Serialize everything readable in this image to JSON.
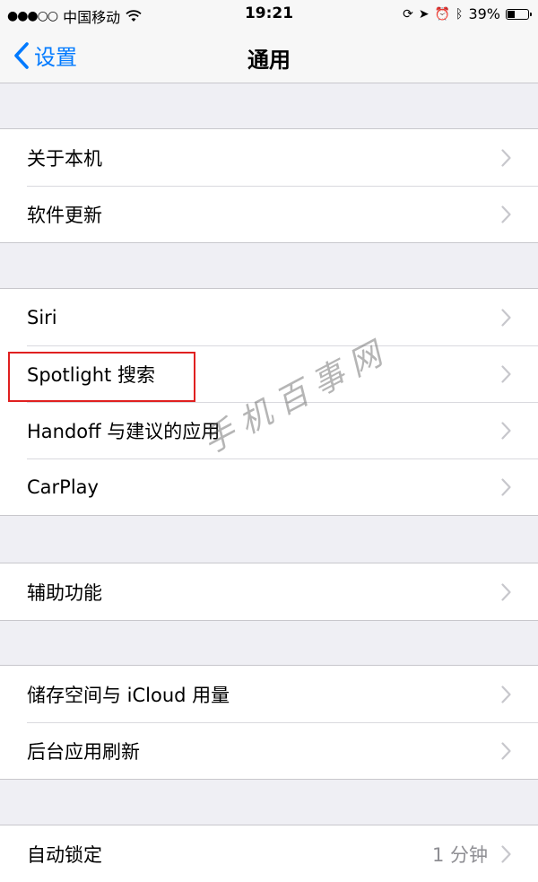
{
  "status_bar": {
    "signal": "●●●○○",
    "carrier": "中国移动",
    "time": "19:21",
    "battery_percent": "39%",
    "battery_level": 0.39,
    "icons": [
      "wifi-icon",
      "rotation-lock-icon",
      "location-arrow-icon",
      "alarm-icon",
      "bluetooth-icon",
      "battery-icon"
    ]
  },
  "nav": {
    "back_label": "设置",
    "title": "通用"
  },
  "groups": [
    {
      "rows": [
        {
          "label": "关于本机"
        },
        {
          "label": "软件更新"
        }
      ]
    },
    {
      "rows": [
        {
          "label": "Siri"
        },
        {
          "label": "Spotlight 搜索"
        },
        {
          "label": "Handoff 与建议的应用"
        },
        {
          "label": "CarPlay"
        }
      ]
    },
    {
      "rows": [
        {
          "label": "辅助功能"
        }
      ]
    },
    {
      "rows": [
        {
          "label": "储存空间与 iCloud 用量"
        },
        {
          "label": "后台应用刷新"
        }
      ]
    },
    {
      "rows": [
        {
          "label": "自动锁定",
          "value": "1 分钟"
        }
      ]
    }
  ],
  "watermark": "手机百事网",
  "colors": {
    "accent": "#007aff",
    "background": "#efeff4",
    "highlight": "#e02020"
  }
}
